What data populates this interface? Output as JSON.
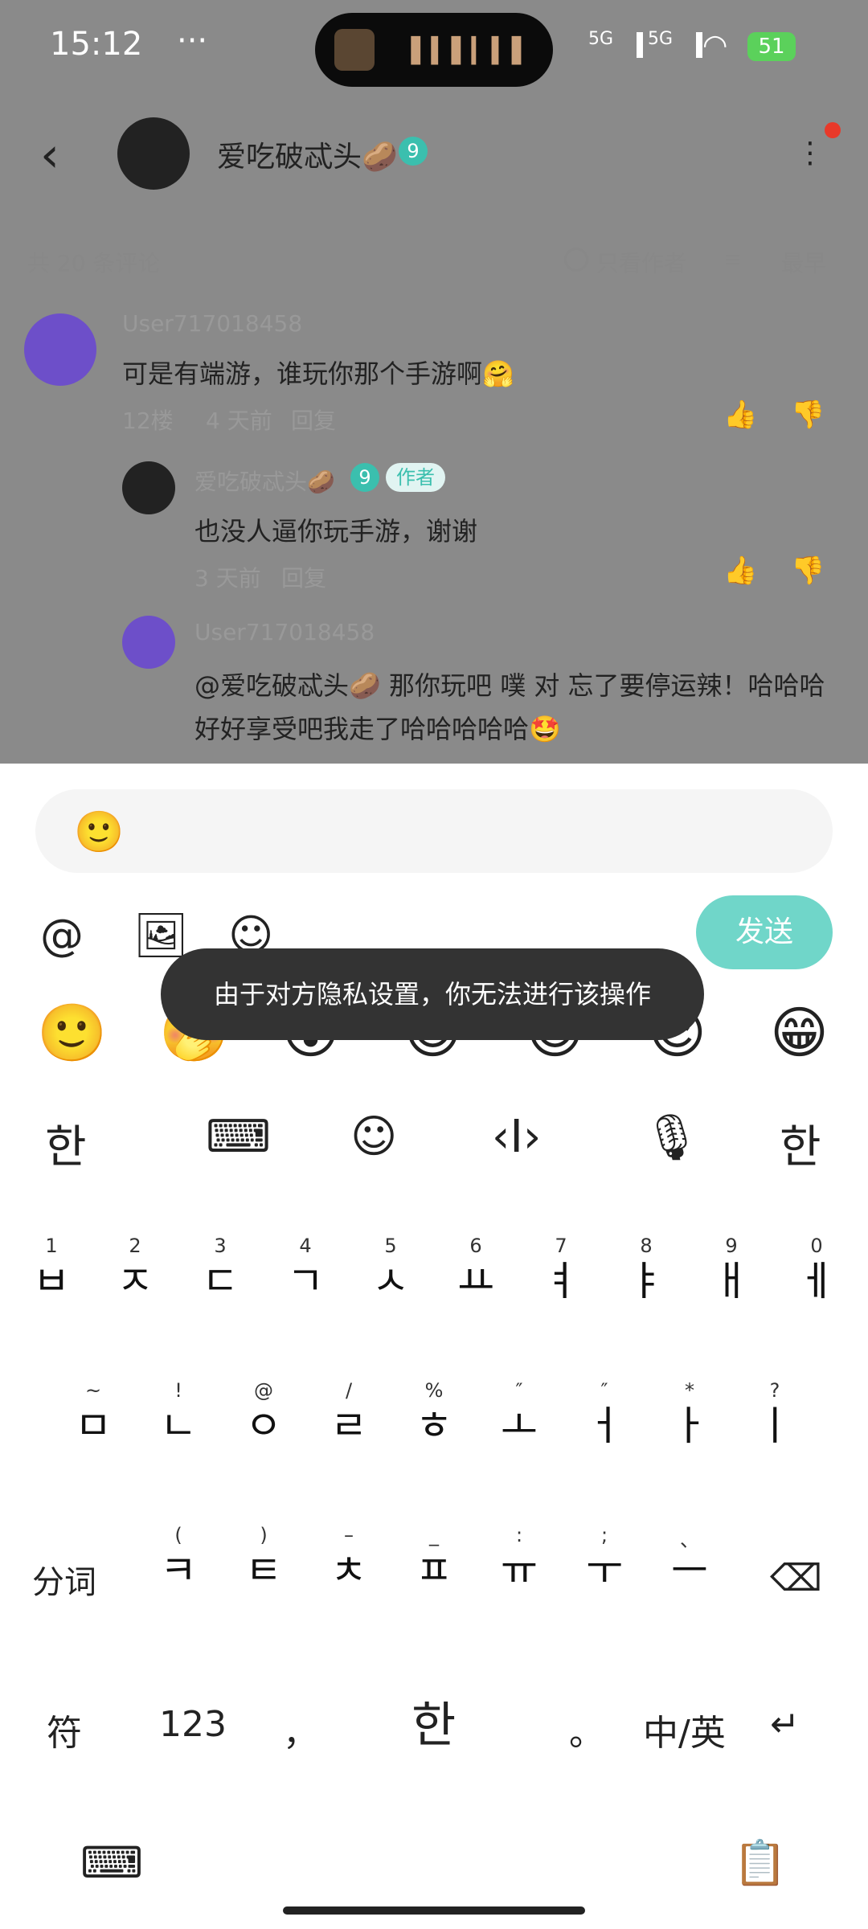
{
  "status_bar": {
    "time": "15:12",
    "more": "···",
    "signal1": "5G",
    "signal2": "5G",
    "battery": "51"
  },
  "header": {
    "username": "爱吃破忒头🥔",
    "level": "9"
  },
  "comments_bar": {
    "count": "共 20 条评论",
    "only_author": "只看作者",
    "sort": "最早"
  },
  "comments": [
    {
      "name": "User717018458",
      "text": "可是有端游，谁玩你那个手游啊🤗",
      "meta_floor": "12楼",
      "meta_time": "4 天前",
      "meta_reply": "回复"
    },
    {
      "name": "爱吃破忒头🥔",
      "level": "9",
      "badge": "作者",
      "text": "也没人逼你玩手游，谢谢",
      "meta_time": "3 天前",
      "meta_reply": "回复"
    },
    {
      "name": "User717018458",
      "text": "@爱吃破忒头🥔  那你玩吧 噗 对 忘了要停运辣！哈哈哈好好享受吧我走了哈哈哈哈哈🤩"
    }
  ],
  "input": {
    "emoji": "🙂"
  },
  "toolbar": {
    "at": "@",
    "image": "🖼",
    "emoji": "☺",
    "send": "发送"
  },
  "toast": "由于对方隐私设置，你无法进行该操作",
  "emojis": [
    "🙂",
    "🤭",
    "😲",
    "😊",
    "😎",
    "😉",
    "😁"
  ],
  "keyboard": {
    "tools": [
      "한",
      "⌨",
      "☺",
      "‹I›",
      "🎙",
      "한"
    ],
    "row1": [
      [
        "1",
        "ㅂ"
      ],
      [
        "2",
        "ㅈ"
      ],
      [
        "3",
        "ㄷ"
      ],
      [
        "4",
        "ㄱ"
      ],
      [
        "5",
        "ㅅ"
      ],
      [
        "6",
        "ㅛ"
      ],
      [
        "7",
        "ㅕ"
      ],
      [
        "8",
        "ㅑ"
      ],
      [
        "9",
        "ㅐ"
      ],
      [
        "0",
        "ㅔ"
      ]
    ],
    "row2": [
      [
        "~",
        "ㅁ"
      ],
      [
        "!",
        "ㄴ"
      ],
      [
        "@",
        "ㅇ"
      ],
      [
        "/",
        "ㄹ"
      ],
      [
        "%",
        "ㅎ"
      ],
      [
        "″",
        "ㅗ"
      ],
      [
        "″",
        "ㅓ"
      ],
      [
        "*",
        "ㅏ"
      ],
      [
        "?",
        "ㅣ"
      ]
    ],
    "row3_left": "分词",
    "row3": [
      [
        "(",
        "ㅋ"
      ],
      [
        ")",
        "ㅌ"
      ],
      [
        "–",
        "ㅊ"
      ],
      [
        "_",
        "ㅍ"
      ],
      [
        ":",
        "ㅠ"
      ],
      [
        ";",
        "ㅜ"
      ],
      [
        "、",
        "ㅡ"
      ]
    ],
    "backspace": "⌫",
    "bottom": [
      "符",
      "123",
      "，",
      "한",
      "。",
      "中/英",
      "↵"
    ],
    "bottom_icons": [
      "⌨",
      "📋"
    ]
  }
}
